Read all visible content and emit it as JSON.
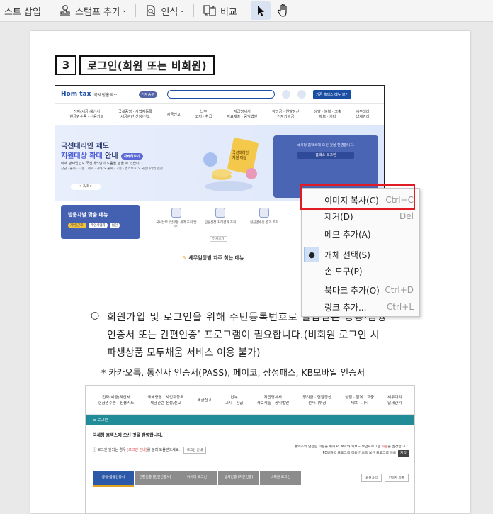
{
  "toolbar": {
    "items": [
      {
        "label": "스트 삽입"
      },
      {
        "label": "스탬프 추가",
        "icon": "stamp-icon"
      },
      {
        "label": "인식",
        "icon": "recognize-icon"
      },
      {
        "label": "비교",
        "icon": "compare-icon"
      }
    ],
    "tools": [
      {
        "icon": "select-arrow-icon",
        "active": true
      },
      {
        "icon": "hand-tool-icon",
        "active": false
      }
    ]
  },
  "document": {
    "section_number": "3",
    "section_title": "로그인(회원 또는 비회원)",
    "bullet": "○",
    "para_line1": "회원가입 및 로그인을 위해 주민등록번호로 발급받은 공동·금융",
    "para_line2_a": "인증서 또는 간편인증",
    "para_line2_sup": "*",
    "para_line2_b": " 프로그램이 필요합니다.(비회원 로그인 시",
    "para_line3": "파생상품 모두채움 서비스 이용 불가)",
    "note": "* 카카오톡, 통신사 인증서(PASS), 페이코, 삼성패스, KB모바일 인증서"
  },
  "hometax_shot": {
    "logo": "Hom tax",
    "logo_sub": "국세청홈택스",
    "badge": "전자송부",
    "top_btn": "기존 홈택스 메뉴 보기",
    "menu": [
      [
        "전자(세금)계산서",
        "현금영수증 · 신용카드"
      ],
      [
        "국세증명 · 사업자등록",
        "세금관련 신청/신고"
      ],
      [
        "세금신고",
        ""
      ],
      [
        "납부",
        "고지 · 환급"
      ],
      [
        "지급명세서",
        "자료제출 · 공익법인"
      ],
      [
        "장려금 · 연말정산",
        "전자기부금"
      ],
      [
        "상담 · 불복 · 고충",
        "제보 · 기타"
      ],
      [
        "세무대리",
        "납세관리"
      ]
    ],
    "hero_line1": "국선대리인 제도",
    "hero_line2_hl": "지원대상 확대",
    "hero_line2_rest": " 안내",
    "hero_tag": "자세히보기",
    "hero_desc": "이제 영세법인도 국선대리인의 도움을 받을 수 있습니다.",
    "hero_desc2": "상담 · 불복 · 고충 · 제보 · 기타 > 불복 · 고충 · 권리보호 > 국선대리인 신청",
    "hero_page": "2/3",
    "hero_art_text": "국선대리인 지원 대상",
    "login_welcome": "국세청 홈택스에 오신 것을 환영합니다.",
    "login_btn": "홈택스 로그인",
    "visit_title": "방문자별 맞춤 메뉴",
    "visit_tags": [
      "개인(근로)",
      "개인사업자",
      "법인"
    ],
    "visit_items": [
      "국세납부 (납부할 세액 조회/납부)",
      "민원신청 처리결과 조회",
      "현금영수증 결과 조회"
    ],
    "visit_more": "전체보기",
    "faq": "세무일정별 자주 찾는 메뉴"
  },
  "context_menu": {
    "items": [
      {
        "label": "이미지 복사(C)",
        "shortcut": "Ctrl+C",
        "checked": false,
        "name": "copy-image"
      },
      {
        "label": "제거(D)",
        "shortcut": "Del",
        "checked": false,
        "name": "remove"
      },
      {
        "label": "메모 추가(A)",
        "shortcut": "",
        "checked": false,
        "name": "add-memo"
      },
      {
        "label": "개체 선택(S)",
        "shortcut": "",
        "checked": true,
        "name": "select-object"
      },
      {
        "label": "손 도구(P)",
        "shortcut": "",
        "checked": false,
        "name": "hand-tool"
      },
      {
        "label": "북마크 추가(O)",
        "shortcut": "Ctrl+D",
        "checked": false,
        "name": "add-bookmark"
      },
      {
        "label": "링크 추가...",
        "shortcut": "Ctrl+L",
        "checked": false,
        "name": "add-link"
      }
    ],
    "highlight_color": "#e01b24"
  },
  "login_shot": {
    "menu": [
      [
        "전자(세금)계산서",
        "현금영수증 · 신용카드"
      ],
      [
        "국세증명 · 사업자등록",
        "세금관련 신청/신고"
      ],
      [
        "세금신고",
        ""
      ],
      [
        "납부",
        "고지 · 환급"
      ],
      [
        "지급명세서",
        "자료제출 · 공익법인"
      ],
      [
        "장려금 · 연말정산",
        "전자기부금"
      ],
      [
        "상담 · 불복 · 고충",
        "제보 · 기타"
      ],
      [
        "세무대리",
        "납세관리"
      ]
    ],
    "bar": "≡  로그인",
    "welcome": "국세청 홈택스에 오신 것을 환영합니다.",
    "left_note_a": "로그인 안되는 경우 ",
    "left_note_red": "[로그인 안내]",
    "left_note_b": "를 눌러 도움받으세요.",
    "left_btn": "로그인 안내",
    "right_line1_a": "홈택스의 안전한 이용을 위해 PC보호와 키보드 보안프로그램 ",
    "right_line1_red": "사용",
    "right_line1_b": "을 권장합니다.",
    "right_line2": "PC방화벽 프로그램 이용    키보드 보안 프로그램 이용",
    "right_btn": "저장",
    "tabs": [
      "공동·금융인증서",
      "간편인증 (민간인증서)",
      "아이디 로그인",
      "생체인증 (지문인증)",
      "비회원 로그인"
    ],
    "tab_btns": [
      "회원가입",
      "인증서 등록"
    ]
  }
}
